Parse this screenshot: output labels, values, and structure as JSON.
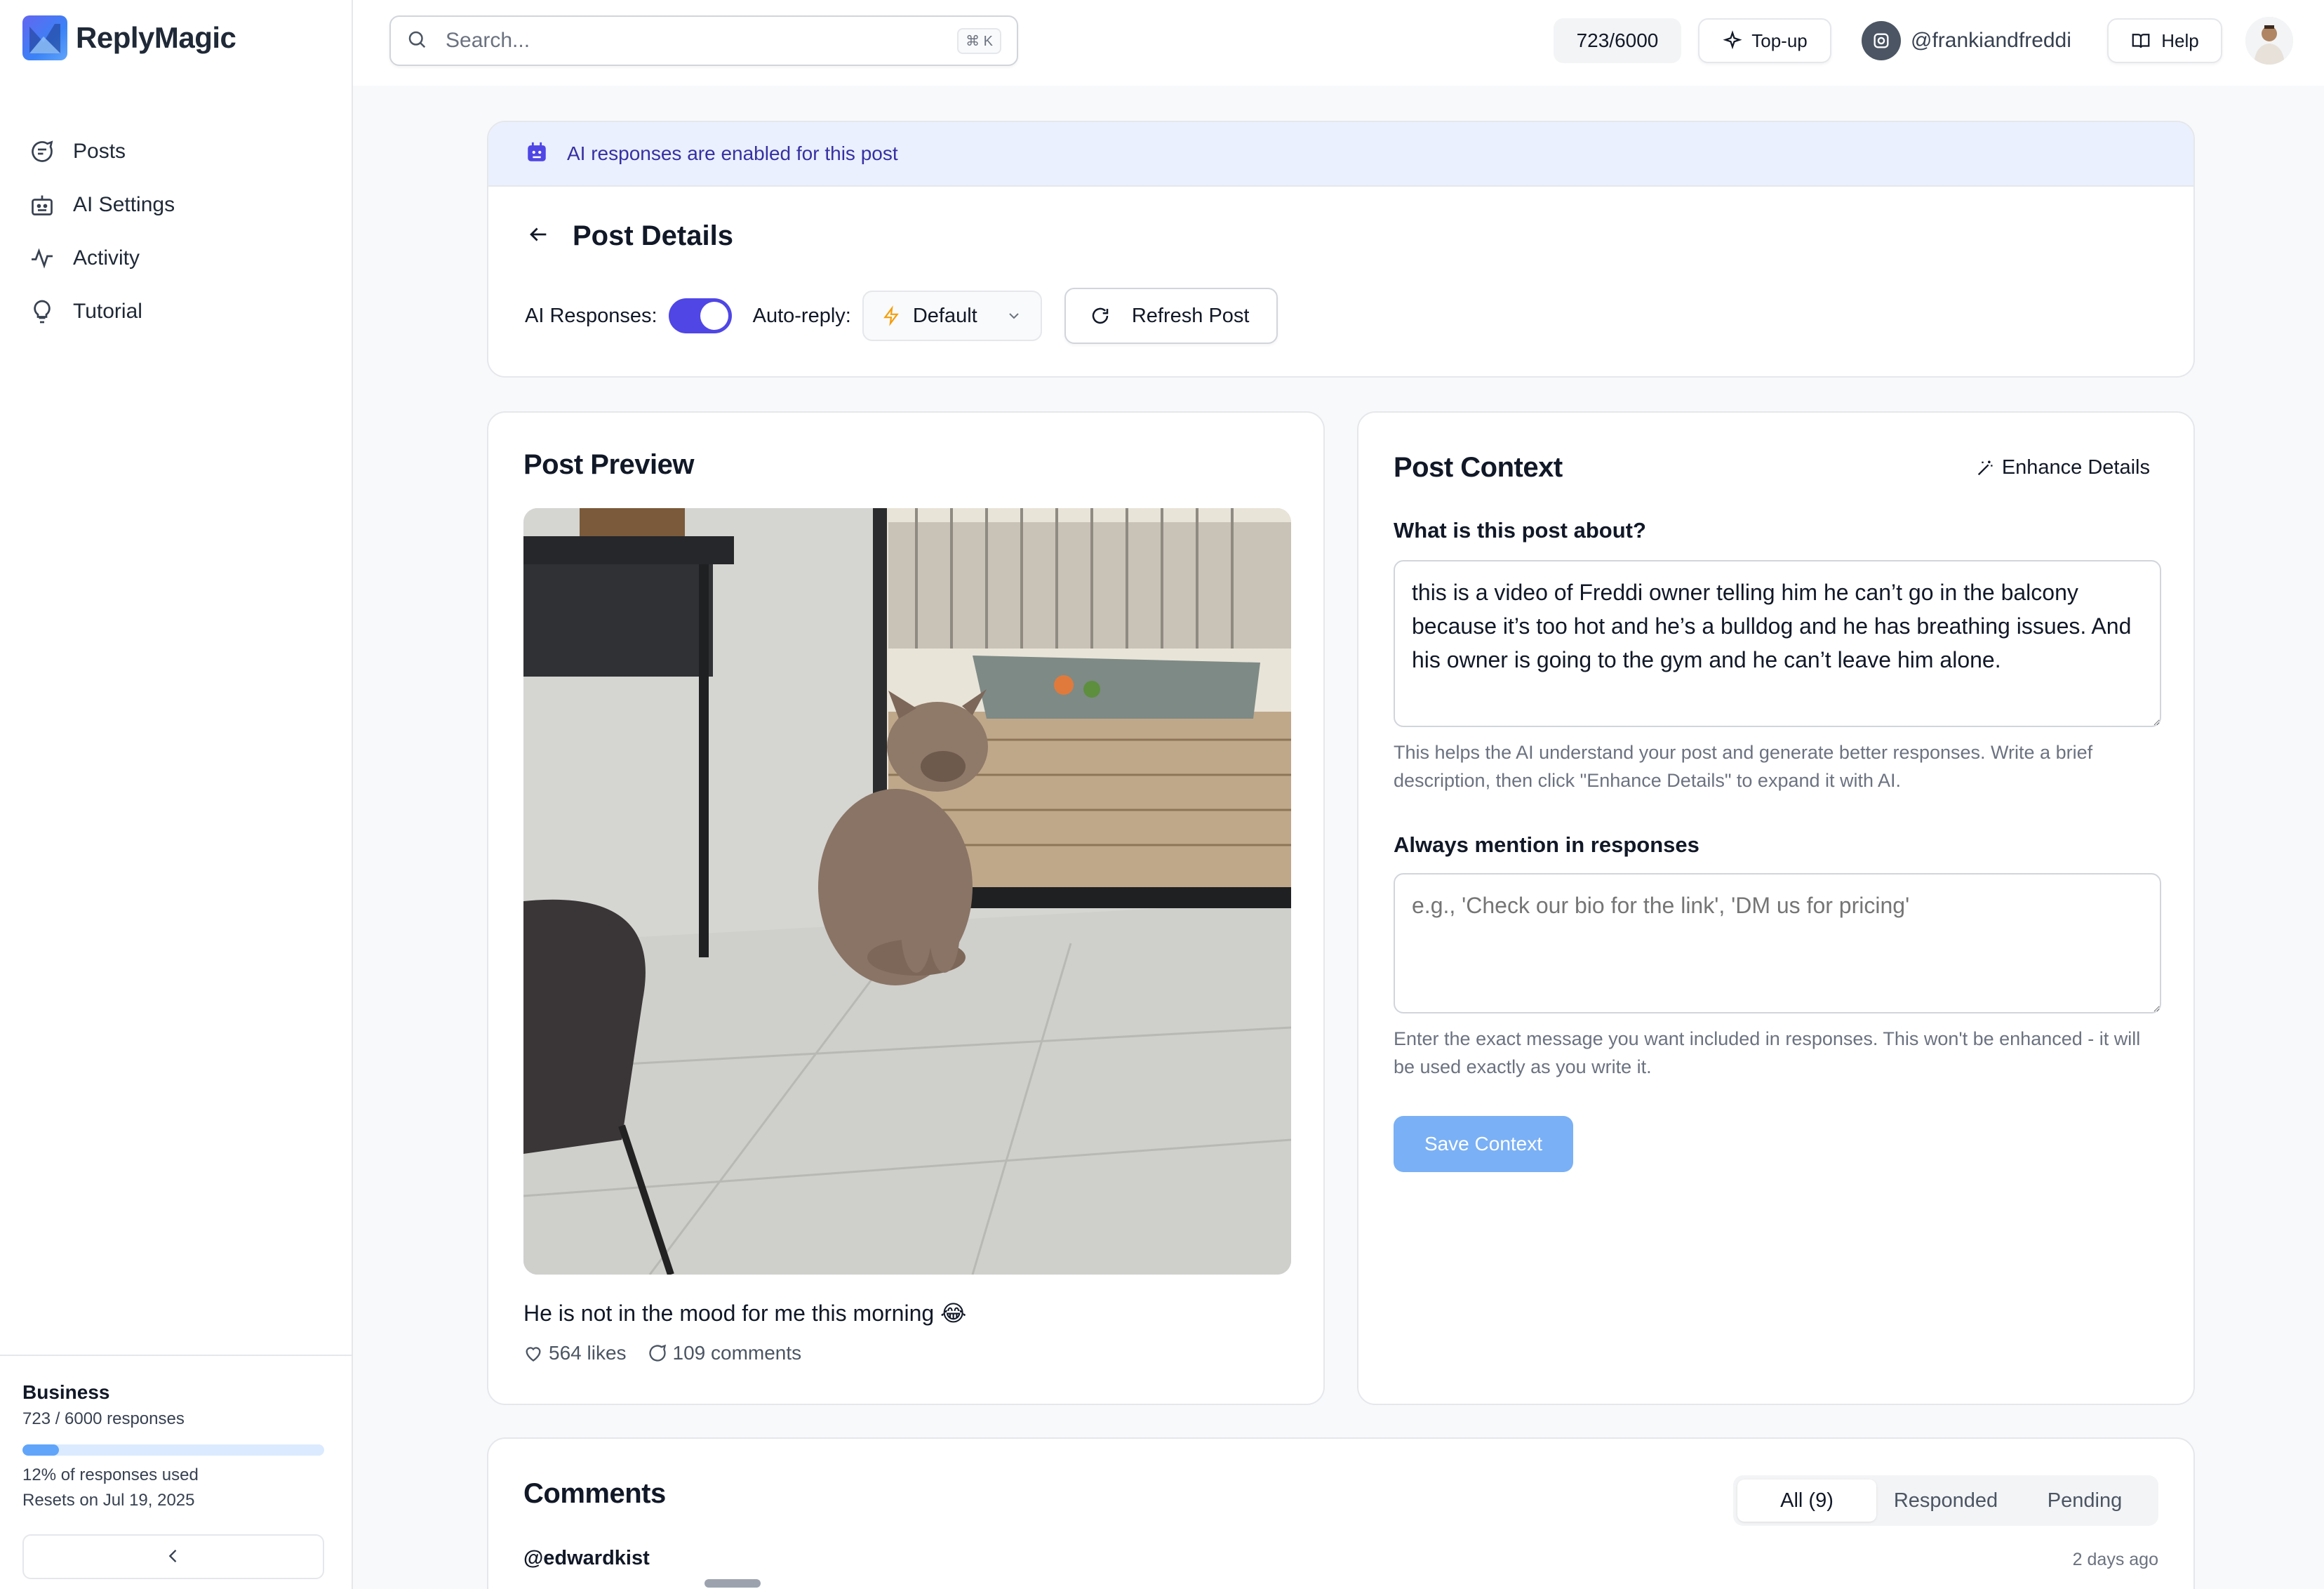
{
  "app": {
    "name": "ReplyMagic"
  },
  "sidebar": {
    "items": [
      {
        "label": "Posts",
        "icon": "message-circle-icon"
      },
      {
        "label": "AI Settings",
        "icon": "bot-icon"
      },
      {
        "label": "Activity",
        "icon": "activity-icon"
      },
      {
        "label": "Tutorial",
        "icon": "lightbulb-icon"
      }
    ],
    "plan": {
      "name": "Business",
      "count": "723 / 6000 responses",
      "usage_percent": 12,
      "used_text": "12% of responses used",
      "reset_text": "Resets on Jul 19, 2025"
    }
  },
  "topbar": {
    "search_placeholder": "Search...",
    "shortcut": "⌘ K",
    "credits": "723/6000",
    "topup_label": "Top-up",
    "account": "@frankiandfreddi",
    "help_label": "Help"
  },
  "post_header": {
    "banner": "AI responses are enabled for this post",
    "title": "Post Details",
    "ai_responses_label": "AI Responses:",
    "ai_responses_on": true,
    "auto_reply_label": "Auto-reply:",
    "auto_reply_value": "Default",
    "refresh_label": "Refresh Post"
  },
  "preview": {
    "title": "Post Preview",
    "caption": "He is not in the mood for me this morning 😂",
    "likes": "564 likes",
    "comments": "109 comments"
  },
  "context": {
    "title": "Post Context",
    "enhance_label": "Enhance Details",
    "about_label": "What is this post about?",
    "about_value": "this is a video of Freddi owner telling him he can’t go in the balcony because it’s too hot and he’s a bulldog and he has breathing issues. And his owner is going to the gym and he can’t leave him alone.",
    "about_hint": "This helps the AI understand your post and generate better responses. Write a brief description, then click \"Enhance Details\" to expand it with AI.",
    "mention_label": "Always mention in responses",
    "mention_placeholder": "e.g., 'Check our bio for the link', 'DM us for pricing'",
    "mention_hint": "Enter the exact message you want included in responses. This won't be enhanced - it will be used exactly as you write it.",
    "save_label": "Save Context"
  },
  "comments": {
    "title": "Comments",
    "tabs": [
      "All (9)",
      "Responded",
      "Pending"
    ],
    "first_user": "@edwardkist",
    "first_time": "2 days ago"
  },
  "colors": {
    "accent": "#4f46e5",
    "save_button": "#7ab0f5",
    "banner_bg": "#eaf0fd"
  }
}
